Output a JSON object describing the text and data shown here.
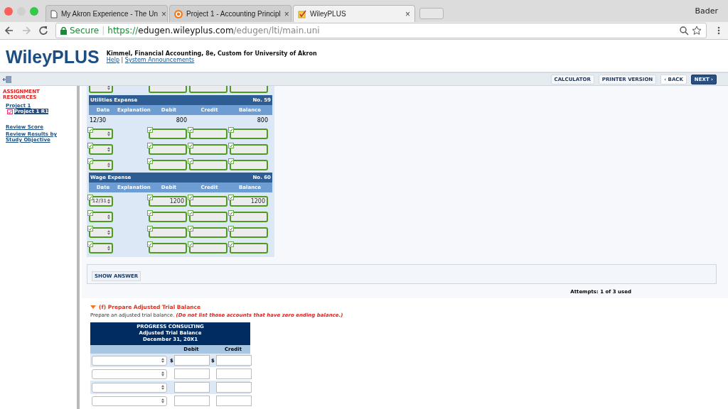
{
  "browser": {
    "tabs": [
      {
        "title": "My Akron Experience - The Un",
        "kind": "page",
        "selected": false
      },
      {
        "title": "Project 1 - Accounting Principl",
        "kind": "badge",
        "selected": false
      },
      {
        "title": "WileyPLUS",
        "kind": "check",
        "selected": true
      }
    ],
    "tab_close": "×",
    "user": "Bader",
    "url_divider": "|",
    "secure_label": "Secure",
    "url_scheme": "https://",
    "url_host": "edugen.wileyplus.com",
    "url_path": "/edugen/lti/main.uni"
  },
  "header": {
    "logo": "WileyPLUS",
    "course": "Kimmel, Financial Accounting, 8e, Custom for University of Akron",
    "links": [
      "Help",
      "System Announcements"
    ],
    "separator": "|"
  },
  "toolbar": {
    "buttons": [
      {
        "label": "CALCULATOR",
        "kind": "plain"
      },
      {
        "label": "PRINTER VERSION",
        "kind": "plain"
      },
      {
        "label": "‹ BACK",
        "kind": "back"
      },
      {
        "label": "NEXT ›",
        "kind": "primary"
      }
    ]
  },
  "sidebar": {
    "heading": "ASSIGNMENT RESOURCES",
    "items": [
      {
        "label": "Project 1",
        "selected": false,
        "children": [
          {
            "label": "Project 1 R1",
            "selected": true
          }
        ]
      },
      {
        "label": "Review Score",
        "selected": false
      },
      {
        "label": "Review Results by Study Objective",
        "selected": false
      }
    ]
  },
  "ledger": {
    "leading_row": {
      "kind": "input"
    },
    "accounts": [
      {
        "name": "Utilities Expense",
        "number": "No. 59",
        "columns": [
          "Date",
          "Explanation",
          "Debit",
          "Credit",
          "Balance"
        ],
        "entries": [
          {
            "kind": "static",
            "date": "12/30",
            "debit": "800",
            "balance": "800"
          },
          {
            "kind": "input",
            "checked": true
          },
          {
            "kind": "input",
            "checked": true
          },
          {
            "kind": "input",
            "checked": true
          }
        ]
      },
      {
        "name": "Wage Expense",
        "number": "No. 60",
        "columns": [
          "Date",
          "Explanation",
          "Debit",
          "Credit",
          "Balance"
        ],
        "entries": [
          {
            "kind": "input",
            "checked": true,
            "date": "12/31",
            "debit": "1200",
            "balance": "1200"
          },
          {
            "kind": "input",
            "checked": true
          },
          {
            "kind": "input",
            "checked": true
          },
          {
            "kind": "input",
            "checked": true
          }
        ]
      }
    ]
  },
  "show_answer": "SHOW ANSWER",
  "attempts": "Attempts: 1 of 3 used",
  "part_f": {
    "title": "(f) Prepare Adjusted Trial Balance",
    "expanded": true,
    "instruction": "Prepare an adjusted trial balance. *(Do not list those accounts that have zero ending balance.)*",
    "trial_balance": {
      "heading": [
        "PROGRESS CONSULTING",
        "Adjusted Trial Balance",
        "December 31, 20X1"
      ],
      "columns": [
        "Debit",
        "Credit"
      ],
      "rows": [
        {
          "kind": "first",
          "currency": "$"
        },
        {
          "kind": "plain"
        },
        {
          "kind": "plain"
        },
        {
          "kind": "plain"
        }
      ]
    }
  }
}
